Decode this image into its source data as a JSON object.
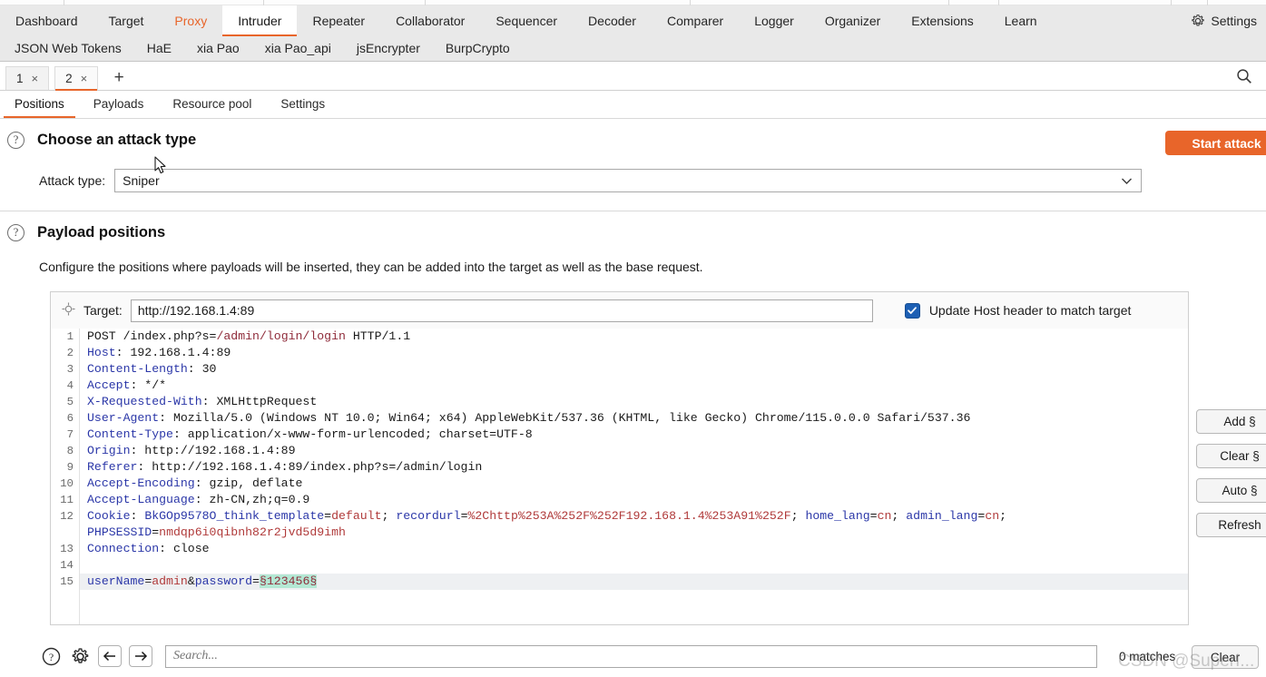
{
  "main_tabs": [
    {
      "label": "Dashboard",
      "state": "normal"
    },
    {
      "label": "Target",
      "state": "normal"
    },
    {
      "label": "Proxy",
      "state": "highlight"
    },
    {
      "label": "Intruder",
      "state": "active"
    },
    {
      "label": "Repeater",
      "state": "normal"
    },
    {
      "label": "Collaborator",
      "state": "normal"
    },
    {
      "label": "Sequencer",
      "state": "normal"
    },
    {
      "label": "Decoder",
      "state": "normal"
    },
    {
      "label": "Comparer",
      "state": "normal"
    },
    {
      "label": "Logger",
      "state": "normal"
    },
    {
      "label": "Organizer",
      "state": "normal"
    },
    {
      "label": "Extensions",
      "state": "normal"
    },
    {
      "label": "Learn",
      "state": "normal"
    }
  ],
  "settings_tab": {
    "label": "Settings",
    "icon": "gear-icon"
  },
  "extension_tabs": [
    {
      "label": "JSON Web Tokens"
    },
    {
      "label": "HaE"
    },
    {
      "label": "xia Pao"
    },
    {
      "label": "xia Pao_api"
    },
    {
      "label": "jsEncrypter"
    },
    {
      "label": "BurpCrypto"
    }
  ],
  "attack_tabs": [
    {
      "label": "1",
      "close": "×",
      "active": false
    },
    {
      "label": "2",
      "close": "×",
      "active": true
    }
  ],
  "new_tab_label": "+",
  "sub_tabs": [
    {
      "label": "Positions",
      "active": true
    },
    {
      "label": "Payloads",
      "active": false
    },
    {
      "label": "Resource pool",
      "active": false
    },
    {
      "label": "Settings",
      "active": false
    }
  ],
  "attack_type_section": {
    "help_icon": "?",
    "title": "Choose an attack type",
    "field_label": "Attack type:",
    "selected": "Sniper"
  },
  "start_attack_button": "Start attack",
  "payload_positions_section": {
    "help_icon": "?",
    "title": "Payload positions",
    "description": "Configure the positions where payloads will be inserted, they can be added into the target as well as the base request."
  },
  "target": {
    "label": "Target:",
    "value": "http://192.168.1.4:89",
    "placeholder": "",
    "icon": "crosshair-icon"
  },
  "update_host_checkbox": {
    "label": "Update Host header to match target",
    "checked": true
  },
  "side_buttons": [
    {
      "label": "Add §"
    },
    {
      "label": "Clear §"
    },
    {
      "label": "Auto §"
    },
    {
      "label": "Refresh"
    }
  ],
  "request": {
    "line_numbers": [
      "1",
      "2",
      "3",
      "4",
      "5",
      "6",
      "7",
      "8",
      "9",
      "10",
      "11",
      "12",
      "",
      "13",
      "14",
      "15"
    ],
    "lines": [
      {
        "n": "1",
        "segs": [
          {
            "t": "POST ",
            "c": "v"
          },
          {
            "t": "/index.php?s=",
            "c": "v"
          },
          {
            "t": "/admin/login/login",
            "c": "u"
          },
          {
            "t": " HTTP/1.1",
            "c": "v"
          }
        ]
      },
      {
        "n": "2",
        "segs": [
          {
            "t": "Host",
            "c": "k"
          },
          {
            "t": ": 192.168.1.4:89",
            "c": "v"
          }
        ]
      },
      {
        "n": "3",
        "segs": [
          {
            "t": "Content-Length",
            "c": "k"
          },
          {
            "t": ": 30",
            "c": "v"
          }
        ]
      },
      {
        "n": "4",
        "segs": [
          {
            "t": "Accept",
            "c": "k"
          },
          {
            "t": ": */*",
            "c": "v"
          }
        ]
      },
      {
        "n": "5",
        "segs": [
          {
            "t": "X-Requested-With",
            "c": "k"
          },
          {
            "t": ": XMLHttpRequest",
            "c": "v"
          }
        ]
      },
      {
        "n": "6",
        "segs": [
          {
            "t": "User-Agent",
            "c": "k"
          },
          {
            "t": ": Mozilla/5.0 (Windows NT 10.0; Win64; x64) AppleWebKit/537.36 (KHTML, like Gecko) Chrome/115.0.0.0 Safari/537.36",
            "c": "v"
          }
        ]
      },
      {
        "n": "7",
        "segs": [
          {
            "t": "Content-Type",
            "c": "k"
          },
          {
            "t": ": application/x-www-form-urlencoded; charset=UTF-8",
            "c": "v"
          }
        ]
      },
      {
        "n": "8",
        "segs": [
          {
            "t": "Origin",
            "c": "k"
          },
          {
            "t": ": http://192.168.1.4:89",
            "c": "v"
          }
        ]
      },
      {
        "n": "9",
        "segs": [
          {
            "t": "Referer",
            "c": "k"
          },
          {
            "t": ": http://192.168.1.4:89/index.php?s=/admin/login",
            "c": "v"
          }
        ]
      },
      {
        "n": "10",
        "segs": [
          {
            "t": "Accept-Encoding",
            "c": "k"
          },
          {
            "t": ": gzip, deflate",
            "c": "v"
          }
        ]
      },
      {
        "n": "11",
        "segs": [
          {
            "t": "Accept-Language",
            "c": "k"
          },
          {
            "t": ": zh-CN,zh;q=0.9",
            "c": "v"
          }
        ]
      },
      {
        "n": "12",
        "segs": [
          {
            "t": "Cookie",
            "c": "k"
          },
          {
            "t": ": ",
            "c": "v"
          },
          {
            "t": "BkGOp9578O_think_template",
            "c": "k"
          },
          {
            "t": "=",
            "c": "v"
          },
          {
            "t": "default",
            "c": "r"
          },
          {
            "t": "; ",
            "c": "v"
          },
          {
            "t": "recordurl",
            "c": "k"
          },
          {
            "t": "=",
            "c": "v"
          },
          {
            "t": "%2Chttp%253A%252F%252F192.168.1.4%253A91%252F",
            "c": "r"
          },
          {
            "t": "; ",
            "c": "v"
          },
          {
            "t": "home_lang",
            "c": "k"
          },
          {
            "t": "=",
            "c": "v"
          },
          {
            "t": "cn",
            "c": "r"
          },
          {
            "t": "; ",
            "c": "v"
          },
          {
            "t": "admin_lang",
            "c": "k"
          },
          {
            "t": "=",
            "c": "v"
          },
          {
            "t": "cn",
            "c": "r"
          },
          {
            "t": ";",
            "c": "v"
          }
        ]
      },
      {
        "n": "",
        "segs": [
          {
            "t": "PHPSESSID",
            "c": "k"
          },
          {
            "t": "=",
            "c": "v"
          },
          {
            "t": "nmdqp6i0qibnh82r2jvd5d9imh",
            "c": "r"
          }
        ]
      },
      {
        "n": "13",
        "segs": [
          {
            "t": "Connection",
            "c": "k"
          },
          {
            "t": ": close",
            "c": "v"
          }
        ]
      },
      {
        "n": "14",
        "segs": [
          {
            "t": "",
            "c": "v"
          }
        ]
      },
      {
        "n": "15",
        "highlight": true,
        "segs": [
          {
            "t": "userName",
            "c": "k"
          },
          {
            "t": "=",
            "c": "v"
          },
          {
            "t": "admin",
            "c": "r"
          },
          {
            "t": "&",
            "c": "v"
          },
          {
            "t": "password",
            "c": "k"
          },
          {
            "t": "=",
            "c": "v"
          },
          {
            "t": "§123456§",
            "c": "marker"
          }
        ]
      }
    ]
  },
  "bottom_bar": {
    "help_icon": "?",
    "gear_icon": "gear-icon",
    "back_icon": "arrow-left-icon",
    "forward_icon": "arrow-right-icon",
    "search_placeholder": "Search...",
    "search_value": "",
    "matches": "0 matches",
    "clear_label": "Clear"
  },
  "watermark": "CSDN @SuperI...",
  "colors": {
    "accent": "#e8652a",
    "tabbar_bg": "#e9e9e9",
    "checkbox_blue": "#1c5fb4",
    "marker_green": "#b4e8d4",
    "key_blue": "#2b37a8",
    "value_red": "#b03a3a",
    "url_maroon": "#8f2b3a"
  }
}
